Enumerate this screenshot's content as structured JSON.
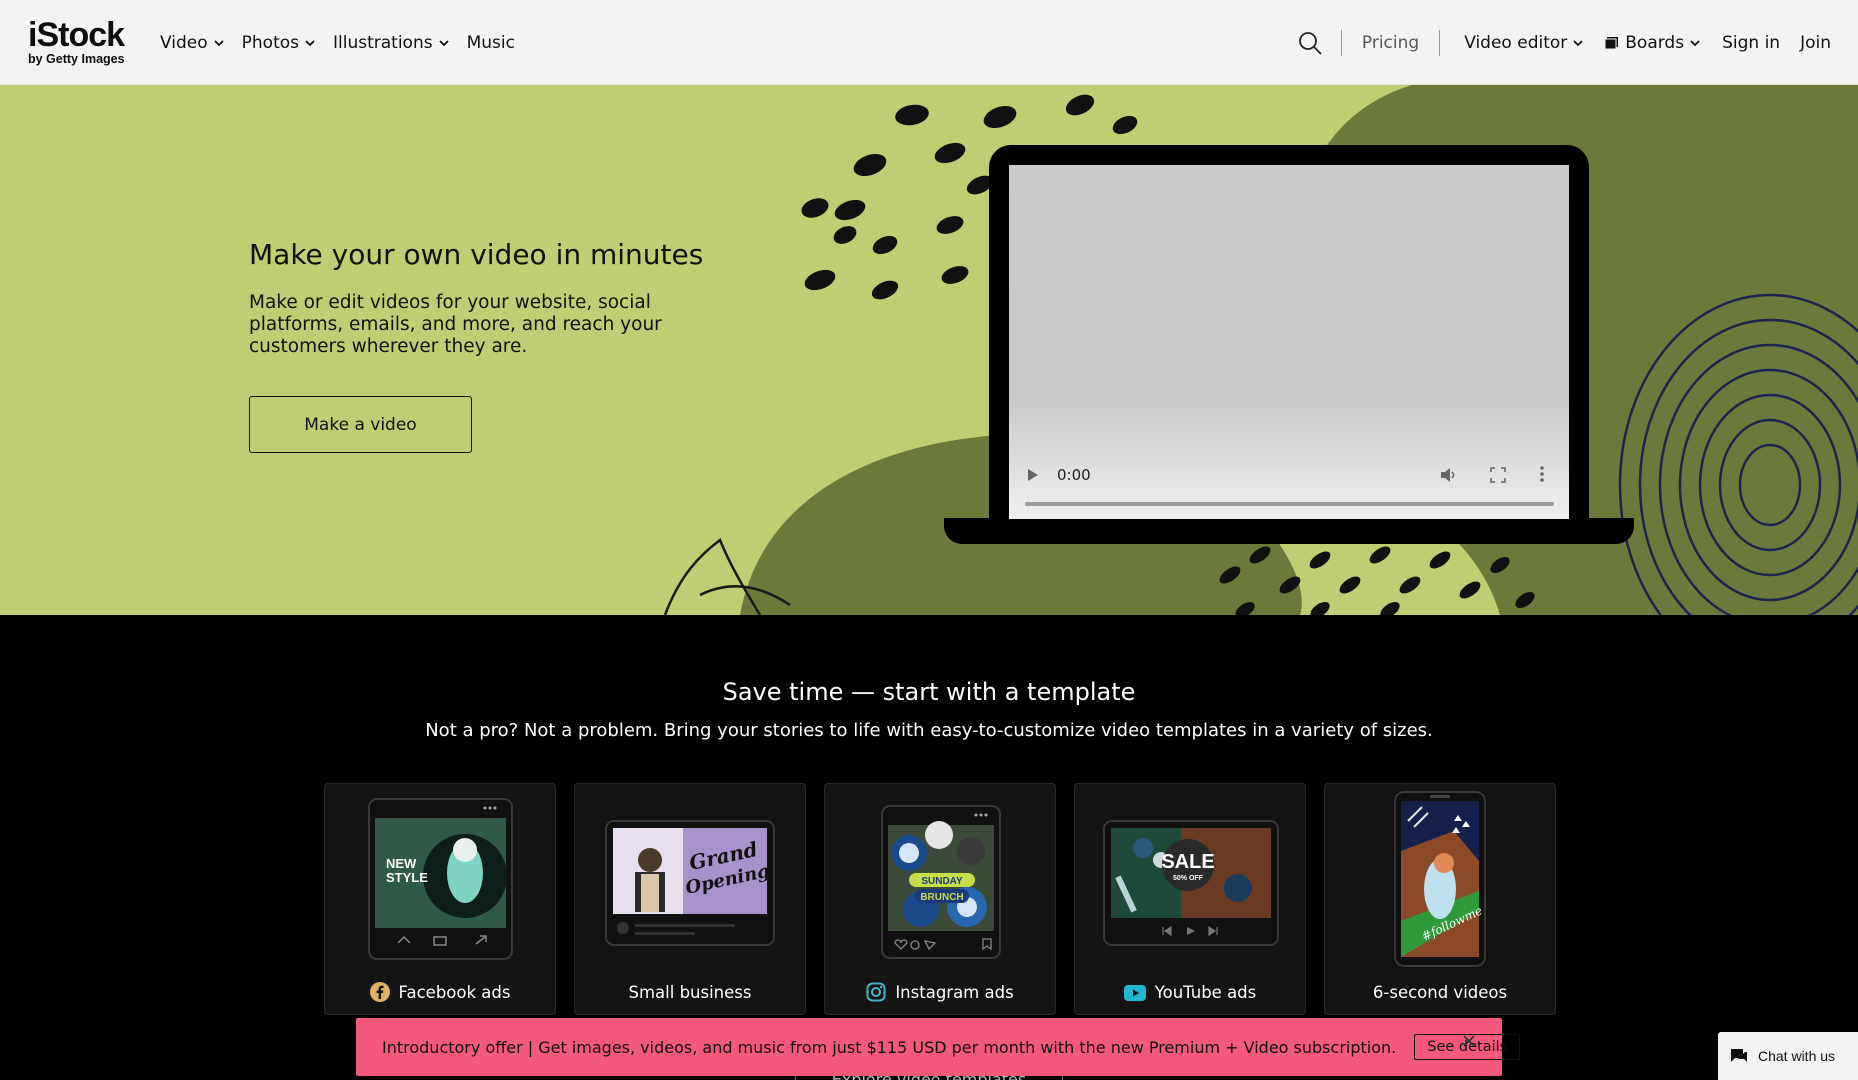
{
  "header": {
    "logo_main": "iStock",
    "logo_sub": "by Getty Images",
    "nav_left": [
      {
        "label": "Video"
      },
      {
        "label": "Photos"
      },
      {
        "label": "Illustrations"
      },
      {
        "label": "Music"
      }
    ],
    "pricing": "Pricing",
    "video_editor": "Video editor",
    "boards": "Boards",
    "sign_in": "Sign in",
    "join": "Join"
  },
  "hero": {
    "title": "Make your own video in minutes",
    "description": "Make or edit videos for your website, social platforms, emails, and more, and reach your customers wherever they are.",
    "cta": "Make a video",
    "video_time": "0:00"
  },
  "templates": {
    "title": "Save time — start with a template",
    "subtitle": "Not a pro? Not a problem. Bring your stories to life with easy-to-customize video templates in a variety of sizes.",
    "cards": [
      {
        "label": "Facebook ads",
        "thumb_text": "NEW\nSTYLE"
      },
      {
        "label": "Small business",
        "thumb_text": "Grand Opening"
      },
      {
        "label": "Instagram ads",
        "thumb_text": "SUNDAY BRUNCH"
      },
      {
        "label": "YouTube ads",
        "thumb_text": "SALE",
        "thumb_sub": "50% OFF"
      },
      {
        "label": "6-second videos",
        "thumb_text": "#followme"
      }
    ],
    "explore_label": "Explore video templates"
  },
  "promo": {
    "text": "Introductory offer | Get images, videos, and music from just $115 USD per month with the new Premium + Video subscription.",
    "button": "See details"
  },
  "chat": {
    "label": "Chat with us"
  },
  "colors": {
    "hero_bg": "#bfce72",
    "hero_dark": "#6b7a3a",
    "promo_bg": "#f4587a",
    "instagram_accent": "#3fb5c9",
    "youtube_accent": "#1fb8d0",
    "facebook_accent": "#e0b062"
  }
}
